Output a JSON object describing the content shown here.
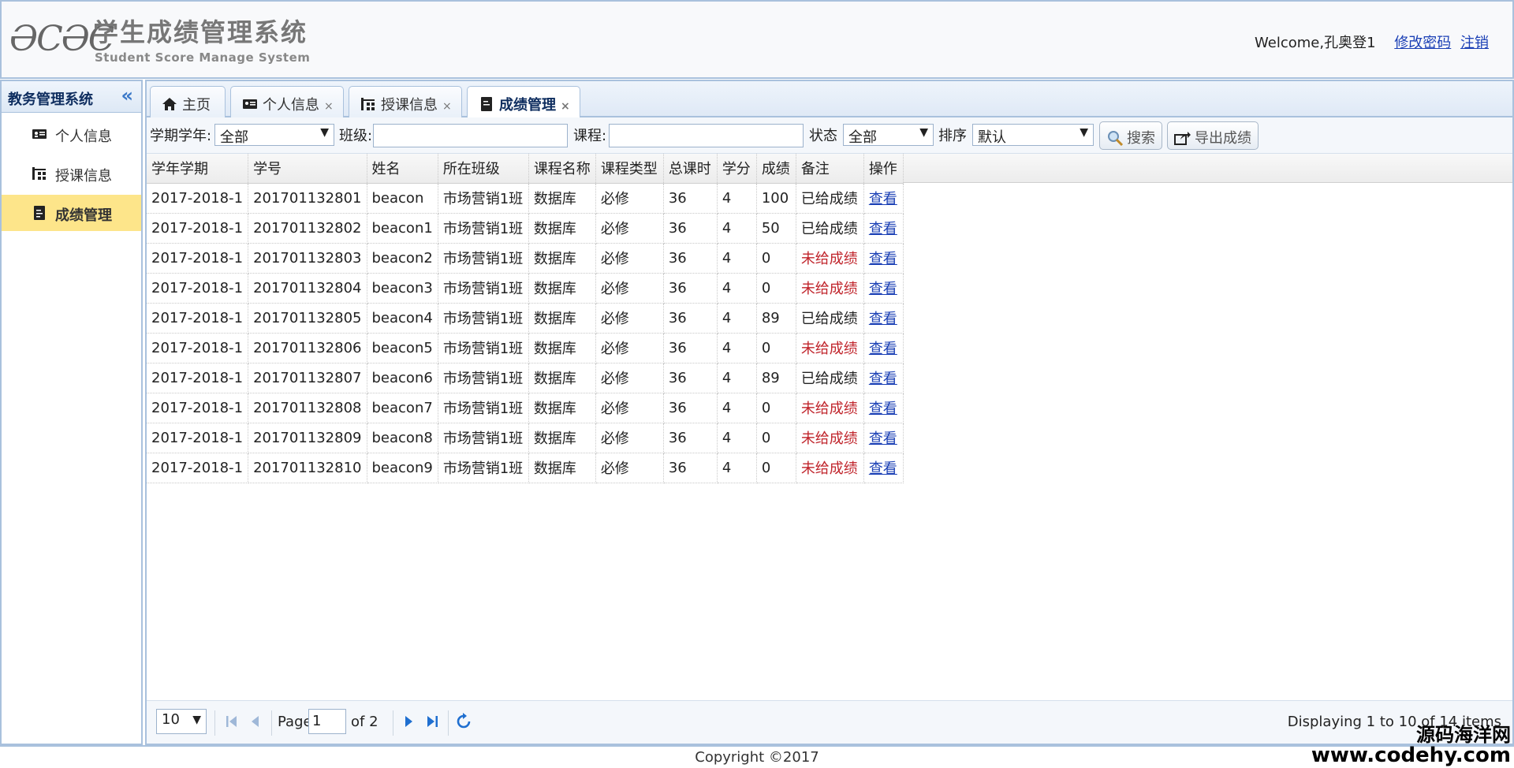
{
  "header": {
    "logo_mark": "ƏCƏC",
    "title_cn": "学生成绩管理系统",
    "title_en": "Student Score Manage System",
    "welcome": "Welcome,孔奥登1",
    "change_password": "修改密码",
    "logout": "注销"
  },
  "sidebar": {
    "title": "教务管理系统",
    "collapse_icon": "«",
    "items": [
      {
        "label": "个人信息",
        "icon": "id-card-icon"
      },
      {
        "label": "授课信息",
        "icon": "hierarchy-icon"
      },
      {
        "label": "成绩管理",
        "icon": "document-icon",
        "active": true
      }
    ]
  },
  "tabs": [
    {
      "label": "主页",
      "icon": "home-icon",
      "closable": false
    },
    {
      "label": "个人信息",
      "icon": "id-card-icon",
      "closable": true
    },
    {
      "label": "授课信息",
      "icon": "hierarchy-icon",
      "closable": true
    },
    {
      "label": "成绩管理",
      "icon": "document-icon",
      "closable": true,
      "active": true
    }
  ],
  "close_glyph": "×",
  "filters": {
    "term_label": "学期学年:",
    "term_value": "全部",
    "class_label": "班级:",
    "class_value": "",
    "course_label": "课程:",
    "course_value": "",
    "status_label": "状态",
    "status_value": "全部",
    "sort_label": "排序",
    "sort_value": "默认",
    "search_button": "搜索",
    "export_button": "导出成绩",
    "dropdown_arrow": "▼"
  },
  "table": {
    "columns": [
      "学年学期",
      "学号",
      "姓名",
      "所在班级",
      "课程名称",
      "课程类型",
      "总课时",
      "学分",
      "成绩",
      "备注",
      "操作"
    ],
    "rows": [
      [
        "2017-2018-1",
        "201701132801",
        "beacon",
        "市场营销1班",
        "数据库",
        "必修",
        "36",
        "4",
        "100",
        "已给成绩",
        "查看"
      ],
      [
        "2017-2018-1",
        "201701132802",
        "beacon1",
        "市场营销1班",
        "数据库",
        "必修",
        "36",
        "4",
        "50",
        "已给成绩",
        "查看"
      ],
      [
        "2017-2018-1",
        "201701132803",
        "beacon2",
        "市场营销1班",
        "数据库",
        "必修",
        "36",
        "4",
        "0",
        "未给成绩",
        "查看"
      ],
      [
        "2017-2018-1",
        "201701132804",
        "beacon3",
        "市场营销1班",
        "数据库",
        "必修",
        "36",
        "4",
        "0",
        "未给成绩",
        "查看"
      ],
      [
        "2017-2018-1",
        "201701132805",
        "beacon4",
        "市场营销1班",
        "数据库",
        "必修",
        "36",
        "4",
        "89",
        "已给成绩",
        "查看"
      ],
      [
        "2017-2018-1",
        "201701132806",
        "beacon5",
        "市场营销1班",
        "数据库",
        "必修",
        "36",
        "4",
        "0",
        "未给成绩",
        "查看"
      ],
      [
        "2017-2018-1",
        "201701132807",
        "beacon6",
        "市场营销1班",
        "数据库",
        "必修",
        "36",
        "4",
        "89",
        "已给成绩",
        "查看"
      ],
      [
        "2017-2018-1",
        "201701132808",
        "beacon7",
        "市场营销1班",
        "数据库",
        "必修",
        "36",
        "4",
        "0",
        "未给成绩",
        "查看"
      ],
      [
        "2017-2018-1",
        "201701132809",
        "beacon8",
        "市场营销1班",
        "数据库",
        "必修",
        "36",
        "4",
        "0",
        "未给成绩",
        "查看"
      ],
      [
        "2017-2018-1",
        "201701132810",
        "beacon9",
        "市场营销1班",
        "数据库",
        "必修",
        "36",
        "4",
        "0",
        "未给成绩",
        "查看"
      ]
    ],
    "status_colors": {
      "已给成绩": "#222222",
      "未给成绩": "#c0242b"
    }
  },
  "pager": {
    "page_size": "10",
    "page_label": "Page",
    "page_value": "1",
    "of_label": "of 2",
    "summary": "Displaying 1 to 10 of 14 items"
  },
  "footer": {
    "copyright": "Copyright ©2017"
  },
  "watermark": {
    "cn": "源码海洋网",
    "en": "www.codehy.com"
  },
  "colors": {
    "border": "#a9c1dd",
    "active_item": "#fde58a",
    "link": "#1a3fb5",
    "ungraded": "#c0242b"
  }
}
